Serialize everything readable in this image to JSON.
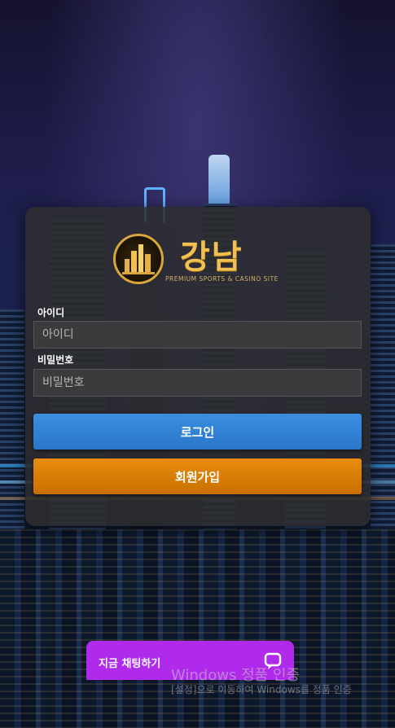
{
  "brand": {
    "name": "강남",
    "tagline": "PREMIUM SPORTS & CASINO SITE"
  },
  "login_form": {
    "id_label": "아이디",
    "id_placeholder": "아이디",
    "password_label": "비밀번호",
    "password_placeholder": "비밀번호",
    "login_button": "로그인",
    "signup_button": "회원가입"
  },
  "chat_widget": {
    "label": "지금 채팅하기",
    "icon": "chat-bubble-icon",
    "color": "#b02aeb"
  },
  "watermark": {
    "title": "Windows 정품 인증",
    "subtitle": "[설정]으로 이동하여 Windows를 정품 인증"
  },
  "colors": {
    "login": "#3a8ee0",
    "signup": "#e88d0c",
    "brand_gold": "#f0c050"
  }
}
